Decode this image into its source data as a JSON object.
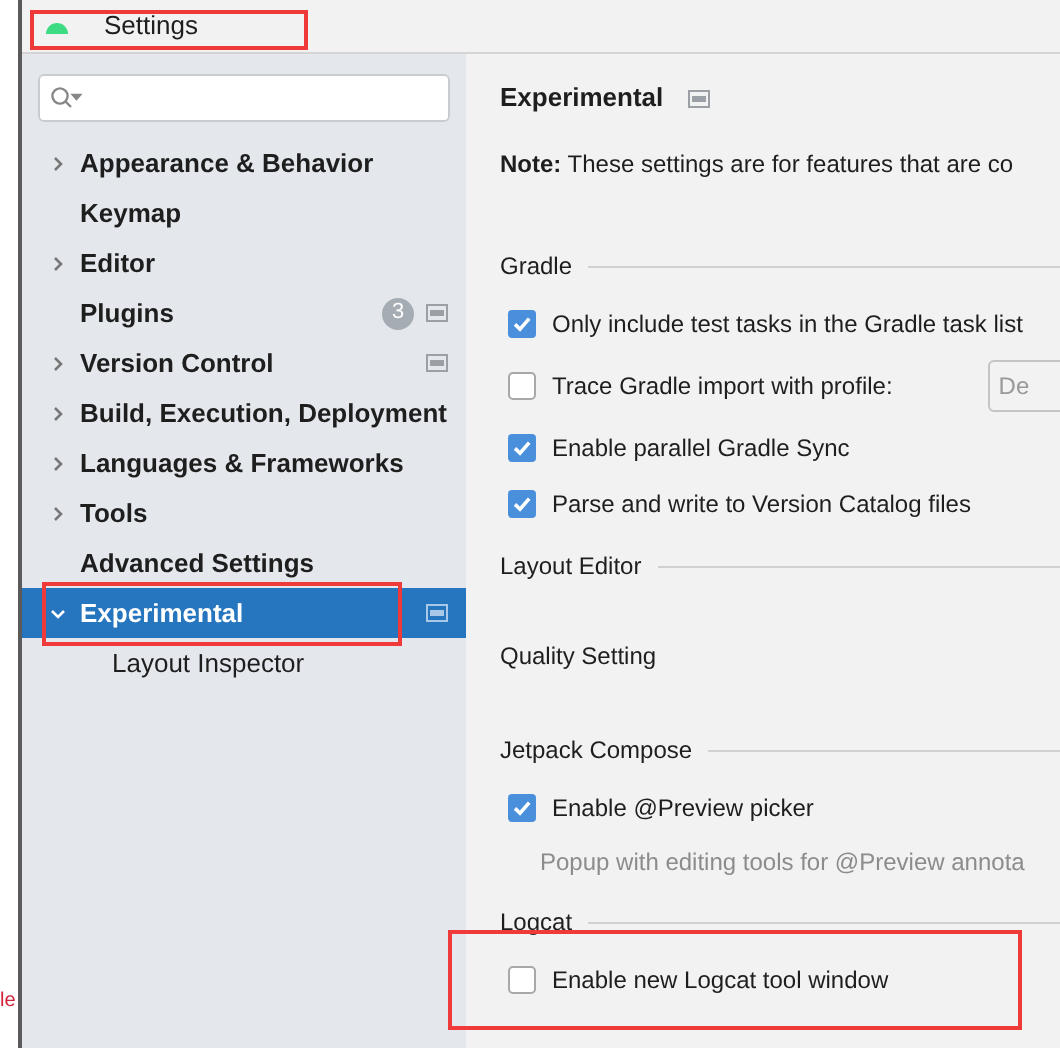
{
  "window": {
    "title": "Settings"
  },
  "background_window": {
    "fragment": "le"
  },
  "sidebar": {
    "items": [
      {
        "label": "Appearance & Behavior",
        "expandable": true,
        "expanded": false,
        "selected": false,
        "options_icon": false
      },
      {
        "label": "Keymap",
        "expandable": false,
        "expanded": false,
        "selected": false,
        "options_icon": false
      },
      {
        "label": "Editor",
        "expandable": true,
        "expanded": false,
        "selected": false,
        "options_icon": false
      },
      {
        "label": "Plugins",
        "expandable": false,
        "expanded": false,
        "selected": false,
        "badge": "3",
        "options_icon": true
      },
      {
        "label": "Version Control",
        "expandable": true,
        "expanded": false,
        "selected": false,
        "options_icon": true
      },
      {
        "label": "Build, Execution, Deployment",
        "expandable": true,
        "expanded": false,
        "selected": false,
        "options_icon": false
      },
      {
        "label": "Languages & Frameworks",
        "expandable": true,
        "expanded": false,
        "selected": false,
        "options_icon": false
      },
      {
        "label": "Tools",
        "expandable": true,
        "expanded": false,
        "selected": false,
        "options_icon": false
      },
      {
        "label": "Advanced Settings",
        "expandable": false,
        "expanded": false,
        "selected": false,
        "options_icon": false
      },
      {
        "label": "Experimental",
        "expandable": true,
        "expanded": true,
        "selected": true,
        "options_icon": true,
        "children": [
          {
            "label": "Layout Inspector",
            "selected": false
          }
        ]
      }
    ]
  },
  "content": {
    "title": "Experimental",
    "note": "**Note:** These settings are for features that are co",
    "sections": [
      {
        "title": "Gradle",
        "items": [
          {
            "kind": "checkbox",
            "label": "Only include test tasks in the Gradle task list",
            "checked": true
          },
          {
            "kind": "checkbox",
            "label": "Trace Gradle import with profile:",
            "checked": false,
            "dropdown": "De"
          },
          {
            "kind": "checkbox",
            "label": "Enable parallel Gradle Sync",
            "checked": true
          },
          {
            "kind": "checkbox",
            "label": "Parse and write to Version Catalog files",
            "checked": true
          }
        ]
      },
      {
        "title": "Layout Editor",
        "items": [
          {
            "kind": "label",
            "label": "Quality Setting"
          }
        ]
      },
      {
        "title": "Jetpack Compose",
        "items": [
          {
            "kind": "checkbox",
            "label": "Enable @Preview picker",
            "checked": true
          },
          {
            "kind": "hint",
            "label": "Popup with editing tools for @Preview annota"
          }
        ]
      },
      {
        "title": "Logcat",
        "items": [
          {
            "kind": "checkbox",
            "label": "Enable new Logcat tool window",
            "checked": false
          }
        ]
      }
    ]
  }
}
